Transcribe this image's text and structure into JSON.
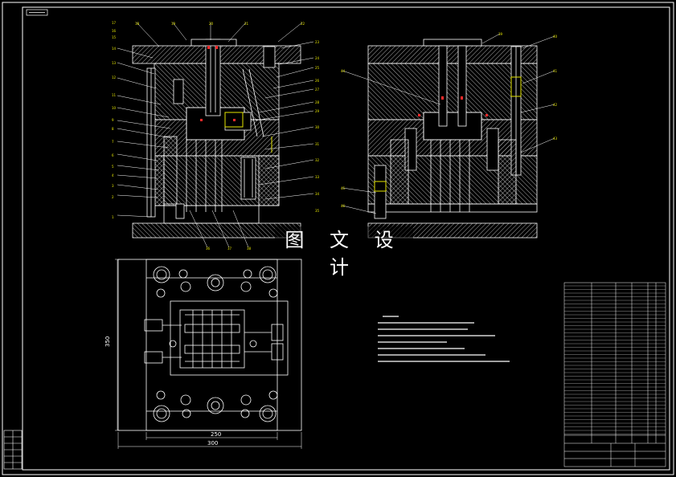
{
  "drawing": {
    "title_tag": "",
    "watermark": "图 文 设 计",
    "dimensions": {
      "height_label": "350",
      "inner_width_label": "250",
      "outer_width_label": "300"
    }
  },
  "colors": {
    "background": "#000000",
    "line": "#ffffff",
    "hatch": "#c8c8c8",
    "callout": "#e6e600",
    "red_marks": "#ff2a2a"
  },
  "callouts_left_column": [
    "1",
    "2",
    "3",
    "4",
    "5",
    "6",
    "7",
    "8",
    "9",
    "10",
    "11",
    "12",
    "13",
    "14",
    "15",
    "16",
    "17"
  ],
  "callouts_top_row": [
    "18",
    "19",
    "20",
    "21",
    "22"
  ],
  "callouts_right_column": [
    "23",
    "24",
    "25",
    "26",
    "27",
    "28",
    "29",
    "30",
    "31",
    "32",
    "33",
    "34",
    "35"
  ],
  "callouts_bottom_row": [
    "36",
    "37",
    "38"
  ],
  "right_view_callouts": [
    "39",
    "40",
    "41",
    "42",
    "43",
    "44",
    "45",
    "46"
  ]
}
